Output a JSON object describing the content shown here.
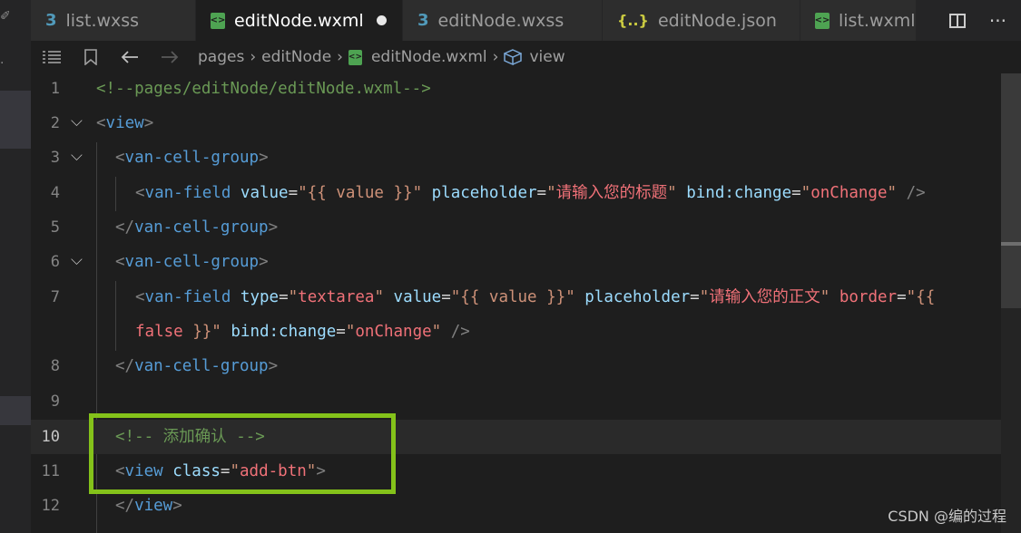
{
  "tabs": [
    {
      "label": "list.wxss",
      "icon": "css-icon",
      "active": false
    },
    {
      "label": "editNode.wxml",
      "icon": "wxml-icon",
      "active": true,
      "modified": true
    },
    {
      "label": "editNode.wxss",
      "icon": "css-icon",
      "active": false
    },
    {
      "label": "editNode.json",
      "icon": "json-icon",
      "active": false
    },
    {
      "label": "list.wxml",
      "icon": "wxml-icon",
      "active": false
    }
  ],
  "tab_actions": {
    "more": "···"
  },
  "breadcrumb": {
    "items": [
      "pages",
      "editNode",
      "editNode.wxml",
      "view"
    ]
  },
  "editor": {
    "line_numbers": [
      "1",
      "2",
      "3",
      "4",
      "5",
      "6",
      "7",
      "",
      "8",
      "9",
      "10",
      "11",
      "12"
    ],
    "current_line": "10",
    "lines": {
      "l1": {
        "comment": "<!--pages/editNode/editNode.wxml-->"
      },
      "l2": {
        "open": "<",
        "tag": "view",
        "close": ">"
      },
      "l3": {
        "open": "<",
        "tag": "van-cell-group",
        "close": ">"
      },
      "l4": {
        "open": "<",
        "tag": "van-field",
        "a1": " value",
        "eq1": "=",
        "v1": "\"{{ value }}\"",
        "a2": " placeholder",
        "eq2": "=",
        "q2a": "\"",
        "v2": "请输入您的标题",
        "q2b": "\"",
        "a3": " bind:change",
        "eq3": "=",
        "q3a": "\"",
        "v3": "onChange",
        "q3b": "\"",
        "close": " />"
      },
      "l5": {
        "open": "</",
        "tag": "van-cell-group",
        "close": ">"
      },
      "l6": {
        "open": "<",
        "tag": "van-cell-group",
        "close": ">"
      },
      "l7": {
        "open": "<",
        "tag": "van-field",
        "a1": " type",
        "eq1": "=",
        "q1a": "\"",
        "v1": "textarea",
        "q1b": "\"",
        "a2": " value",
        "eq2": "=",
        "v2": "\"{{ value }}\"",
        "a3": " placeholder",
        "eq3": "=",
        "q3a": "\"",
        "v3": "请输入您的正文",
        "q3b": "\"",
        "a4": " border",
        "eq4": "=",
        "v4": "\"{{"
      },
      "l7b": {
        "v1": "false",
        "v2": " }}\"",
        "a1": " bind:change",
        "eq1": "=",
        "q1a": "\"",
        "v3": "onChange",
        "q1b": "\"",
        "close": " />"
      },
      "l8": {
        "open": "</",
        "tag": "van-cell-group",
        "close": ">"
      },
      "l10": {
        "comment": "<!-- 添加确认 -->"
      },
      "l11": {
        "open": "<",
        "tag": "view",
        "a1": " class",
        "eq1": "=",
        "q1a": "\"",
        "v1": "add-btn",
        "q1b": "\"",
        "close": ">"
      },
      "l12": {
        "open": "</",
        "tag": "view",
        "close": ">"
      }
    }
  },
  "watermark": "CSDN @编的过程",
  "colors": {
    "highlight_box": "#84c21a",
    "comment": "#6a9955",
    "tag": "#569cd6",
    "attribute": "#9cdcfe",
    "string": "#ce9178"
  }
}
